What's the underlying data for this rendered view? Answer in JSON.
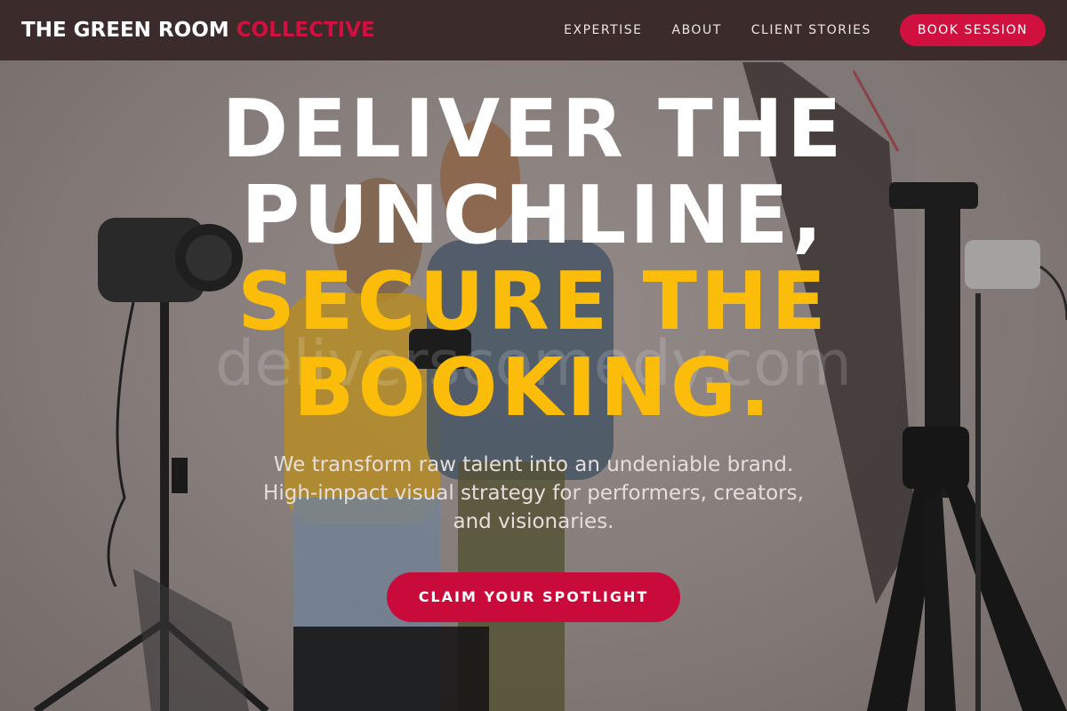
{
  "nav": {
    "brand_main": "THE GREEN ROOM",
    "brand_accent": "COLLECTIVE",
    "links": [
      "EXPERTISE",
      "ABOUT",
      "CLIENT STORIES"
    ],
    "cta": "BOOK SESSION"
  },
  "hero": {
    "title_line1": "DELIVER THE",
    "title_line2": "PUNCHLINE,",
    "title_line3": "SECURE THE",
    "title_line4": "BOOKING.",
    "watermark": "deliverscomedy.com",
    "subtitle_line1": "We transform raw talent into an undeniable brand.",
    "subtitle_line2": "High-impact visual strategy for performers, creators,",
    "subtitle_line3": "and visionaries.",
    "cta": "CLAIM YOUR SPOTLIGHT"
  },
  "colors": {
    "nav_bg": "#3b2b2a",
    "accent_red": "#d0103e",
    "accent_yellow": "#fbbd0a",
    "text_white": "#ffffff"
  }
}
